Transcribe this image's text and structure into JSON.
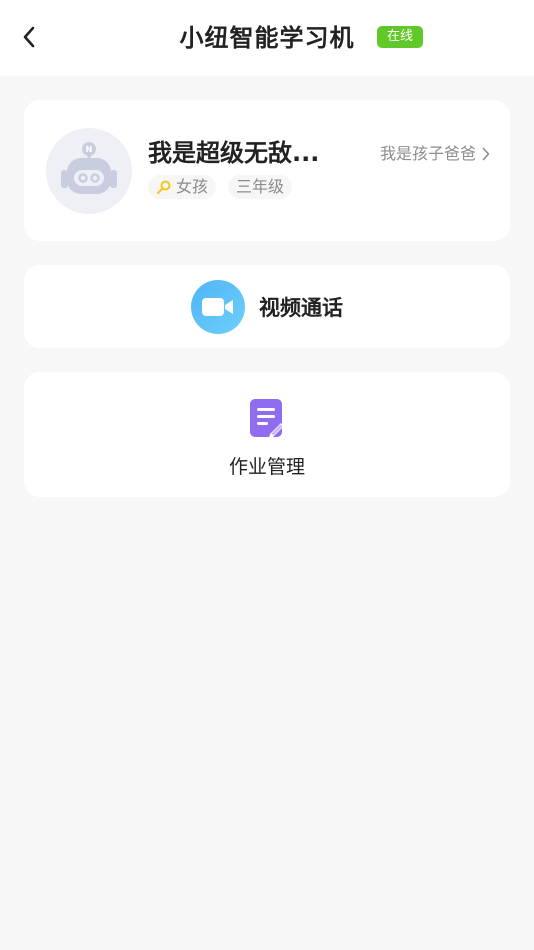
{
  "header": {
    "title": "小纽智能学习机",
    "status_badge": "在线",
    "status_color": "#61c82a"
  },
  "profile": {
    "name": "我是超级无敌...",
    "relation": "我是孩子爸爸",
    "gender": "女孩",
    "grade": "三年级",
    "avatar_icon": "robot-icon"
  },
  "actions": {
    "video_call": "视频通话",
    "homework": "作业管理"
  },
  "icons": {
    "back": "back-chevron-icon",
    "chevron": "chevron-right-icon",
    "gender": "female-icon",
    "video": "video-camera-icon",
    "homework": "document-edit-icon"
  }
}
